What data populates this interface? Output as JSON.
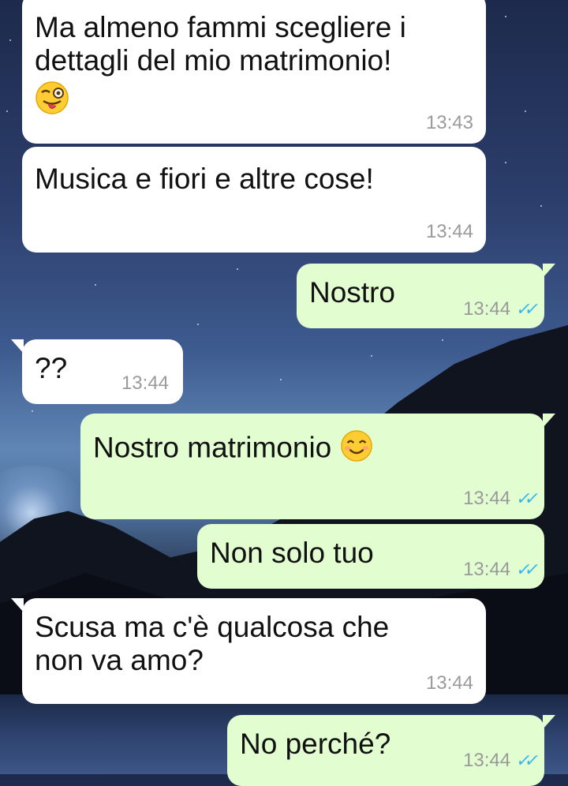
{
  "chat": {
    "messages": [
      {
        "id": "m1",
        "direction": "in",
        "text": "Ma almeno fammi scegliere i\ndettagli del mio matrimonio!",
        "emoji": "winking-face-with-tongue",
        "time": "13:43"
      },
      {
        "id": "m2",
        "direction": "in",
        "text": "Musica e fiori e altre cose!",
        "time": "13:44"
      },
      {
        "id": "m3",
        "direction": "out",
        "text": "Nostro",
        "time": "13:44",
        "status": "read"
      },
      {
        "id": "m4",
        "direction": "in",
        "text": "??",
        "time": "13:44"
      },
      {
        "id": "m5",
        "direction": "out",
        "text": "Nostro matrimonio",
        "emoji": "smiling-face-with-smiling-eyes",
        "time": "13:44",
        "status": "read"
      },
      {
        "id": "m6",
        "direction": "out",
        "text": "Non solo tuo",
        "time": "13:44",
        "status": "read"
      },
      {
        "id": "m7",
        "direction": "in",
        "text": "Scusa ma c'è qualcosa che\nnon va amo?",
        "time": "13:44"
      },
      {
        "id": "m8",
        "direction": "out",
        "text": "No perché?",
        "time": "13:44",
        "status": "read"
      }
    ]
  },
  "colors": {
    "incoming_bubble": "#ffffff",
    "outgoing_bubble": "#e2fdd0",
    "read_ticks": "#34b7f1",
    "timestamp": "#9a9a9a"
  }
}
